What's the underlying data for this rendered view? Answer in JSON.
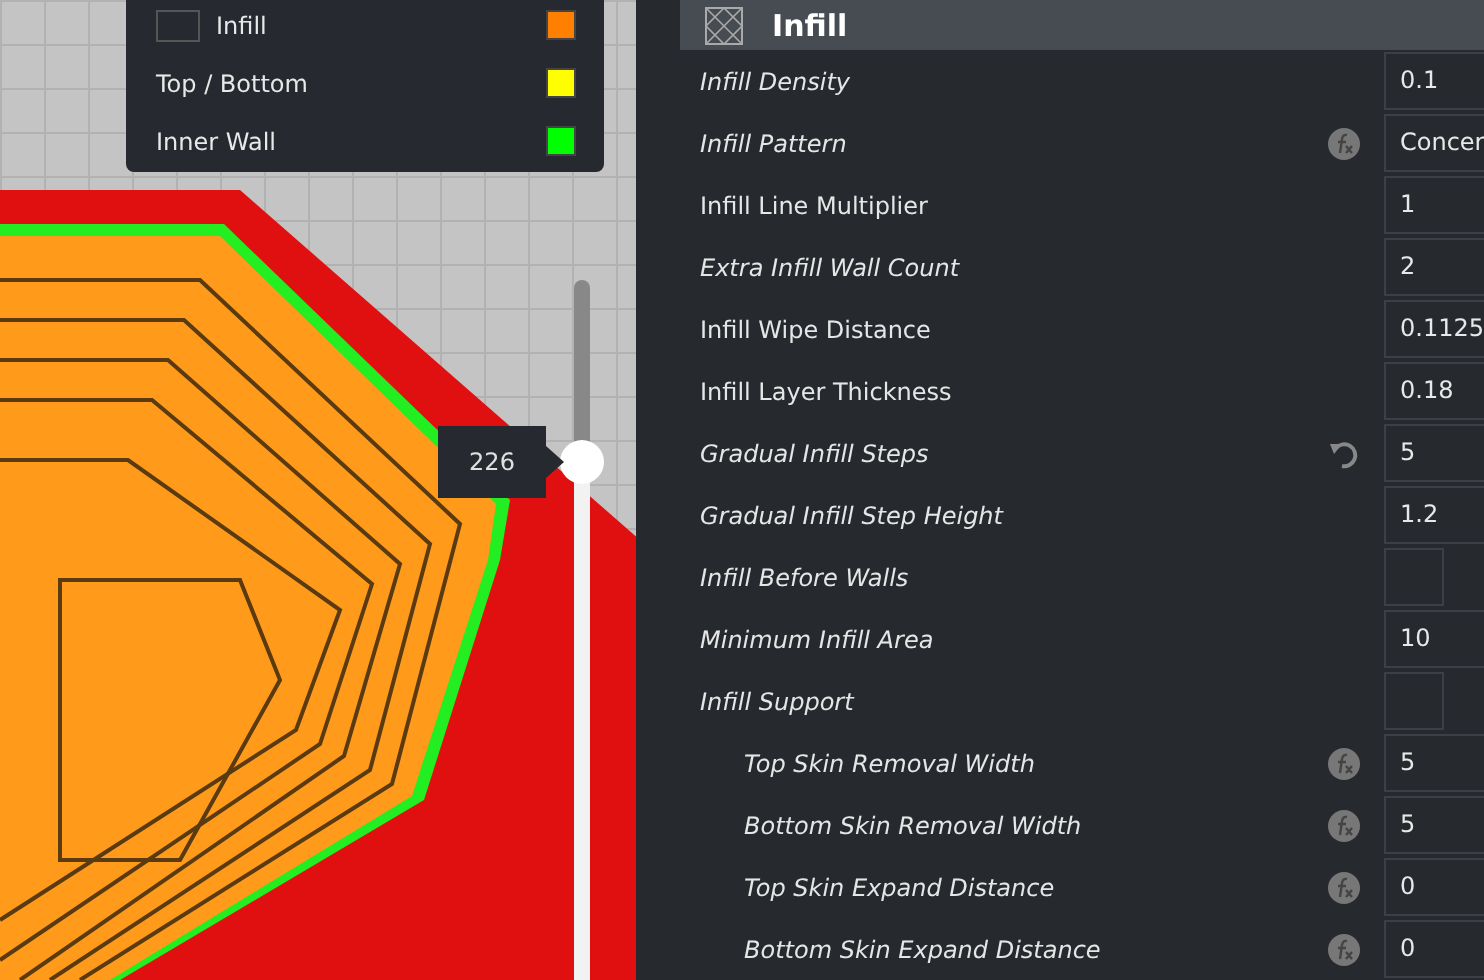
{
  "legend": {
    "items": [
      {
        "label": "Infill",
        "color": "#ff8000"
      },
      {
        "label": "Top / Bottom",
        "color": "#ffff00"
      },
      {
        "label": "Inner Wall",
        "color": "#00ff00"
      }
    ]
  },
  "layer_slider": {
    "value": "226",
    "level": 0.74
  },
  "section": {
    "title": "Infill"
  },
  "settings": [
    {
      "label": "Infill Density",
      "modified": true,
      "formula": false,
      "resettable": false,
      "kind": "text",
      "value": "0.1"
    },
    {
      "label": "Infill Pattern",
      "modified": true,
      "formula": true,
      "resettable": false,
      "kind": "text",
      "value": "Concer"
    },
    {
      "label": "Infill Line Multiplier",
      "modified": false,
      "formula": false,
      "resettable": false,
      "kind": "text",
      "value": "1"
    },
    {
      "label": "Extra Infill Wall Count",
      "modified": true,
      "formula": false,
      "resettable": false,
      "kind": "text",
      "value": "2"
    },
    {
      "label": "Infill Wipe Distance",
      "modified": false,
      "formula": false,
      "resettable": false,
      "kind": "text",
      "value": "0.1125"
    },
    {
      "label": "Infill Layer Thickness",
      "modified": false,
      "formula": false,
      "resettable": false,
      "kind": "text",
      "value": "0.18"
    },
    {
      "label": "Gradual Infill Steps",
      "modified": true,
      "formula": false,
      "resettable": true,
      "kind": "text",
      "value": "5"
    },
    {
      "label": "Gradual Infill Step Height",
      "modified": true,
      "formula": false,
      "resettable": false,
      "kind": "text",
      "value": "1.2"
    },
    {
      "label": "Infill Before Walls",
      "modified": true,
      "formula": false,
      "resettable": false,
      "kind": "checkbox",
      "checked": false
    },
    {
      "label": "Minimum Infill Area",
      "modified": true,
      "formula": false,
      "resettable": false,
      "kind": "text",
      "value": "10"
    },
    {
      "label": "Infill Support",
      "modified": true,
      "formula": false,
      "resettable": false,
      "kind": "checkbox",
      "checked": false,
      "children": [
        {
          "label": "Top Skin Removal Width",
          "modified": true,
          "formula": true,
          "resettable": false,
          "kind": "text",
          "value": "5"
        },
        {
          "label": "Bottom Skin Removal Width",
          "modified": true,
          "formula": true,
          "resettable": false,
          "kind": "text",
          "value": "5"
        },
        {
          "label": "Top Skin Expand Distance",
          "modified": true,
          "formula": true,
          "resettable": false,
          "kind": "text",
          "value": "0"
        },
        {
          "label": "Bottom Skin Expand Distance",
          "modified": true,
          "formula": true,
          "resettable": false,
          "kind": "text",
          "value": "0"
        }
      ]
    }
  ]
}
